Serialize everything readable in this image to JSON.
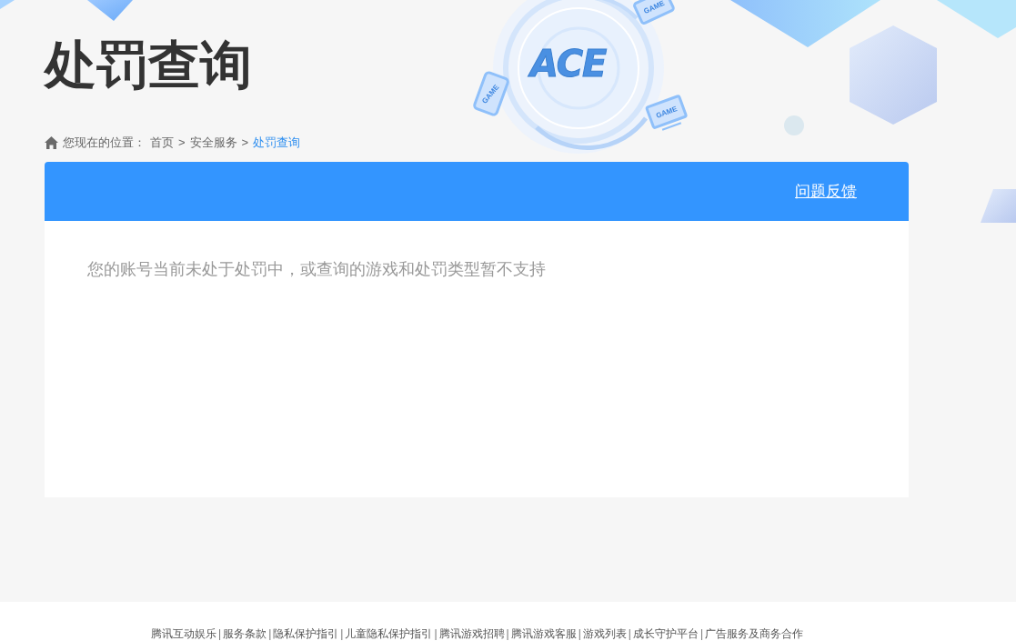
{
  "decor": {
    "logo_text": "ACE",
    "device_labels": [
      "GAME",
      "GAME",
      "GAME"
    ]
  },
  "page": {
    "title": "处罚查询"
  },
  "breadcrumb": {
    "label": "您现在的位置：",
    "parts": [
      {
        "kind": "link",
        "text": "首页",
        "selected": false
      },
      {
        "kind": "separator",
        "text": ">"
      },
      {
        "kind": "link",
        "text": "安全服务",
        "selected": false
      },
      {
        "kind": "separator",
        "text": ">"
      },
      {
        "kind": "link",
        "text": "处罚查询",
        "selected": true
      }
    ]
  },
  "panel": {
    "header_link": "问题反馈",
    "message": "您的账号当前未处于处罚中，或查询的游戏和处罚类型暂不支持"
  },
  "footer": {
    "items": [
      {
        "kind": "link",
        "text": "腾讯互动娱乐"
      },
      {
        "kind": "separator",
        "text": "|"
      },
      {
        "kind": "link",
        "text": "服务条款"
      },
      {
        "kind": "separator",
        "text": "|"
      },
      {
        "kind": "link",
        "text": "隐私保护指引"
      },
      {
        "kind": "separator",
        "text": "|"
      },
      {
        "kind": "link",
        "text": "儿童隐私保护指引"
      },
      {
        "kind": "separator",
        "text": "|"
      },
      {
        "kind": "link",
        "text": "腾讯游戏招聘"
      },
      {
        "kind": "separator",
        "text": "|"
      },
      {
        "kind": "link",
        "text": "腾讯游戏客服"
      },
      {
        "kind": "separator",
        "text": "|"
      },
      {
        "kind": "link",
        "text": "游戏列表"
      },
      {
        "kind": "separator",
        "text": "|"
      },
      {
        "kind": "link",
        "text": "成长守护平台"
      },
      {
        "kind": "separator",
        "text": "|"
      },
      {
        "kind": "link",
        "text": "广告服务及商务合作"
      }
    ]
  }
}
